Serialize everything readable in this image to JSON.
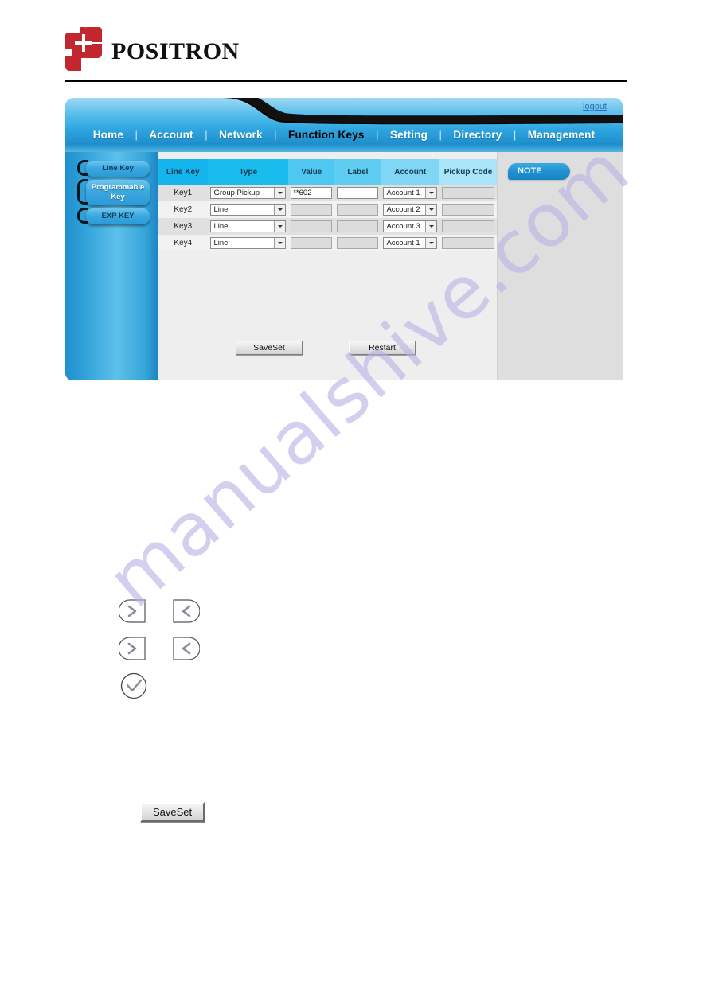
{
  "brand": {
    "wordmark": "POSITRON",
    "logo_icon": "positron-p-cross-logo",
    "logo_color": "#c1272d"
  },
  "watermark": {
    "text": "manualshive.com",
    "color": "#b9b4e6"
  },
  "header": {
    "logout_label": "logout"
  },
  "nav": {
    "items": [
      {
        "label": "Home",
        "active": false
      },
      {
        "label": "Account",
        "active": false
      },
      {
        "label": "Network",
        "active": false
      },
      {
        "label": "Function Keys",
        "active": true
      },
      {
        "label": "Setting",
        "active": false
      },
      {
        "label": "Directory",
        "active": false
      },
      {
        "label": "Management",
        "active": false
      }
    ],
    "separator": "|",
    "accent_color": "#2fa6e0"
  },
  "sidebar": {
    "items": [
      {
        "label": "Line Key",
        "selected": false
      },
      {
        "label": "Programmable Key",
        "selected": true
      },
      {
        "label": "EXP KEY",
        "selected": false
      }
    ]
  },
  "note_panel": {
    "title": "NOTE",
    "body": ""
  },
  "key_table": {
    "columns": [
      "Line Key",
      "Type",
      "Value",
      "Label",
      "Account",
      "Pickup Code"
    ],
    "rows": [
      {
        "key": "Key1",
        "type": "Group Pickup",
        "value": "**602",
        "label": "",
        "account": "Account 1",
        "pickup_code": "",
        "value_enabled": true,
        "label_enabled": true,
        "pickup_enabled": false
      },
      {
        "key": "Key2",
        "type": "Line",
        "value": "",
        "label": "",
        "account": "Account 2",
        "pickup_code": "",
        "value_enabled": false,
        "label_enabled": false,
        "pickup_enabled": false
      },
      {
        "key": "Key3",
        "type": "Line",
        "value": "",
        "label": "",
        "account": "Account 3",
        "pickup_code": "",
        "value_enabled": false,
        "label_enabled": false,
        "pickup_enabled": false
      },
      {
        "key": "Key4",
        "type": "Line",
        "value": "",
        "label": "",
        "account": "Account 1",
        "pickup_code": "",
        "value_enabled": false,
        "label_enabled": false,
        "pickup_enabled": false
      }
    ]
  },
  "panel_buttons": {
    "saveset_label": "SaveSet",
    "restart_label": "Restart"
  },
  "key_glyphs": [
    {
      "name": "right-arrow-key-icon",
      "glyph": ">"
    },
    {
      "name": "left-arrow-key-icon",
      "glyph": "<"
    },
    {
      "name": "right-arrow-key-icon",
      "glyph": ">"
    },
    {
      "name": "left-arrow-key-icon",
      "glyph": "<"
    },
    {
      "name": "check-key-icon",
      "glyph": "check"
    }
  ],
  "bottom_button": {
    "saveset_label": "SaveSet"
  }
}
